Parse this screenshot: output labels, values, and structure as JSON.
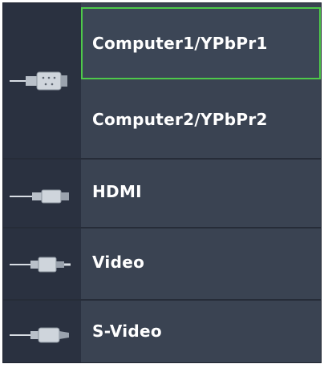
{
  "menu": {
    "items": [
      {
        "id": "computer1",
        "label": "Computer1/YPbPr1",
        "selected": true
      },
      {
        "id": "computer2",
        "label": "Computer2/YPbPr2",
        "selected": false
      },
      {
        "id": "hdmi",
        "label": "HDMI",
        "selected": false
      },
      {
        "id": "video",
        "label": "Video",
        "selected": false
      },
      {
        "id": "svideo",
        "label": "S-Video",
        "selected": false
      }
    ],
    "icons": [
      "vga-connector-icon",
      "hdmi-connector-icon",
      "rca-connector-icon",
      "s-video-connector-icon"
    ]
  },
  "colors": {
    "panel": "#3a4352",
    "icon_column": "#2a3140",
    "selection": "#4ec94a",
    "text": "#ffffff"
  }
}
